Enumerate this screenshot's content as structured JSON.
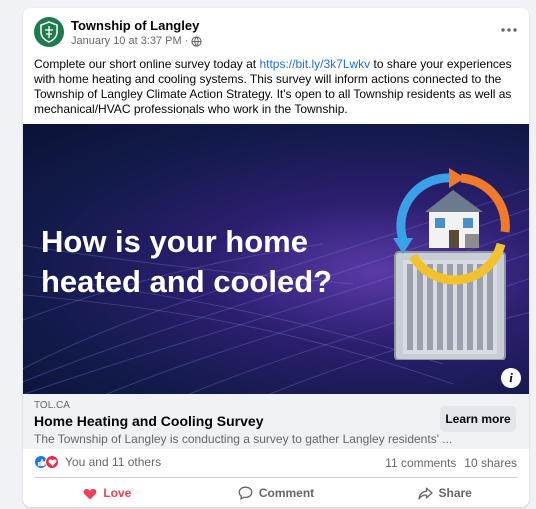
{
  "post": {
    "page_name": "Township of Langley",
    "timestamp": "January 10 at 3:37 PM",
    "separator": "·",
    "audience_icon": "globe-icon",
    "more_icon": "ellipsis-icon",
    "text_before_link": "Complete our short online survey today at ",
    "link": "https://bit.ly/3k7Lwkv",
    "text_after_link": " to share your experiences with home heating and cooling systems. This survey will inform actions connected to the Township of Langley Climate Action Strategy. It's open to all Township residents as well as mechanical/HVAC professionals who work in the Township."
  },
  "hero": {
    "headline": "How is your home heated and cooled?",
    "info_label": "i"
  },
  "link_preview": {
    "domain": "TOL.CA",
    "title": "Home Heating and Cooling Survey",
    "description": "The Township of Langley is conducting a survey to gather Langley residents' ...",
    "cta_label": "Learn more"
  },
  "engagement": {
    "reactors": "You and 11 others",
    "comments": "11 comments",
    "shares": "10 shares"
  },
  "actions": {
    "love_label": "Love",
    "comment_label": "Comment",
    "share_label": "Share"
  },
  "colors": {
    "link": "#216fdb",
    "love": "#f33e58",
    "like": "#1877f2",
    "brand_green": "#1f7a4d"
  }
}
